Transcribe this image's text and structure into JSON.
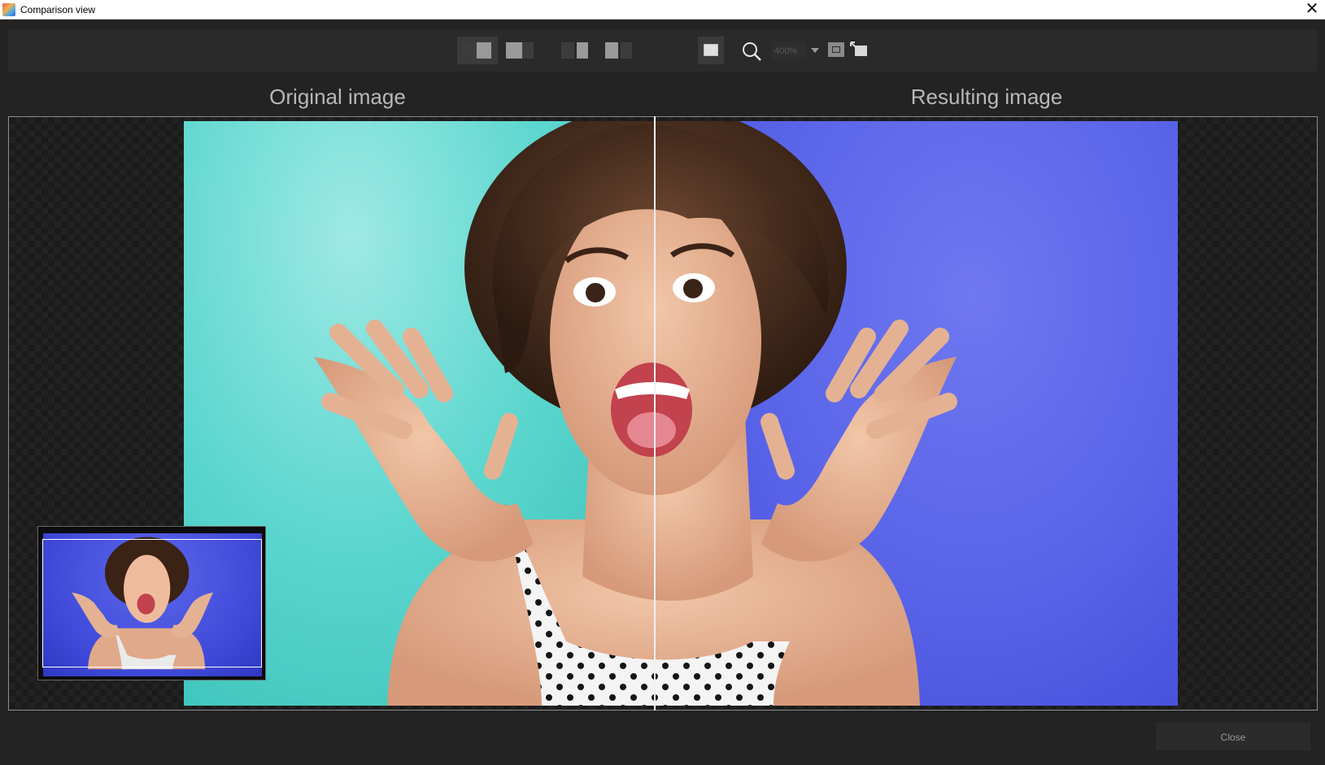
{
  "window": {
    "title": "Comparison view",
    "close_glyph": "✕"
  },
  "toolbar": {
    "zoom_value": "400%",
    "icons": [
      "split-view-icon",
      "single-view-icon",
      "side-by-side-icon",
      "before-after-icon",
      "fullscreen-icon",
      "zoom-icon",
      "zoom-dropdown-icon",
      "fit-to-window-icon",
      "actual-size-icon"
    ]
  },
  "panes": {
    "left_heading": "Original image",
    "right_heading": "Resulting image"
  },
  "colors": {
    "original_background": "#5dd7cf",
    "result_background": "#5762e8",
    "app_background": "#232323"
  },
  "footer": {
    "close_label": "Close"
  }
}
